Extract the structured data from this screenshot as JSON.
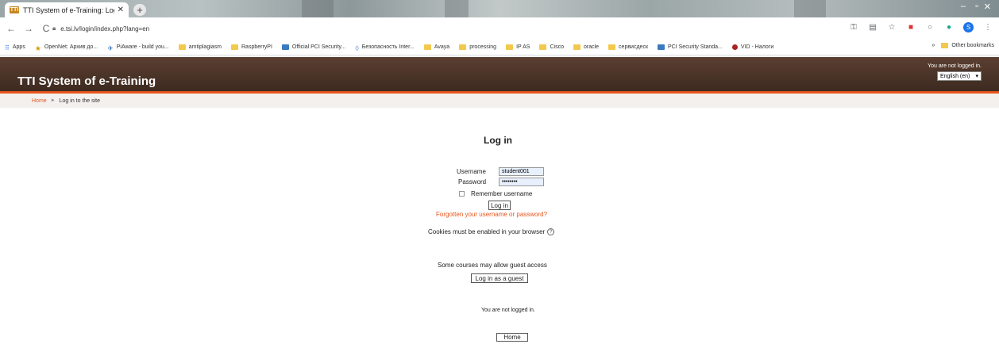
{
  "browser": {
    "tab_title": "TTI System of e-Training: Log in",
    "tab_favicon": "TTI",
    "url": "e.tsi.lv/login/index.php?lang=en",
    "bookmarks": [
      {
        "label": "Apps",
        "icon": "apps-grid-icon"
      },
      {
        "label": "OpenNet: Архив до...",
        "icon": "star-icon"
      },
      {
        "label": "PiAware - build you...",
        "icon": "plane-icon"
      },
      {
        "label": "amtiplagiasm",
        "icon": "folder-icon"
      },
      {
        "label": "RaspberryPI",
        "icon": "folder-icon"
      },
      {
        "label": "Official PCI Security...",
        "icon": "pci-icon"
      },
      {
        "label": "Безопасность Inter...",
        "icon": "shield-icon"
      },
      {
        "label": "Avaya",
        "icon": "folder-icon"
      },
      {
        "label": "processing",
        "icon": "folder-icon"
      },
      {
        "label": "IP AS",
        "icon": "folder-icon"
      },
      {
        "label": "Cisco",
        "icon": "folder-icon"
      },
      {
        "label": "oracle",
        "icon": "folder-icon"
      },
      {
        "label": "сервисдеск",
        "icon": "folder-icon"
      },
      {
        "label": "PCI Security Standa...",
        "icon": "pci-icon"
      },
      {
        "label": "VID - Налоги",
        "icon": "red-dot-icon"
      }
    ],
    "other_bookmarks": "Other bookmarks",
    "more": "»"
  },
  "site": {
    "title": "TTI System of e-Training",
    "login_info": "You are not logged in.",
    "language": "English (en)"
  },
  "breadcrumb": {
    "home": "Home",
    "current": "Log in to the site"
  },
  "login": {
    "heading": "Log in",
    "username_label": "Username",
    "username_value": "student001",
    "password_label": "Password",
    "password_value": "••••••••",
    "remember_label": "Remember username",
    "login_button": "Log in",
    "forgot_link": "Forgotten your username or password?",
    "cookies_text": "Cookies must be enabled in your browser",
    "guest_text": "Some courses may allow guest access",
    "guest_button": "Log in as a guest"
  },
  "footer": {
    "not_logged_in": "You are not logged in.",
    "home_button": "Home"
  },
  "colors": {
    "accent": "#e8551c",
    "header_bg": "#4a3326"
  }
}
